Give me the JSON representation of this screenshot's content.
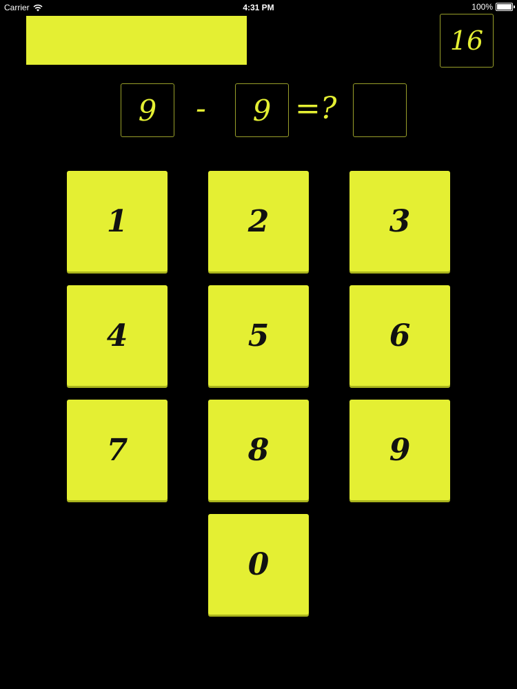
{
  "status_bar": {
    "carrier": "Carrier",
    "time": "4:31 PM",
    "battery": "100%",
    "wifi_icon": "wifi-icon",
    "battery_icon": "battery-icon"
  },
  "progress": {
    "fraction": 1.0,
    "color": "#e4ef33"
  },
  "score": "16",
  "equation": {
    "left_operand": "9",
    "operator": "-",
    "right_operand": "9",
    "equals": "=?",
    "answer": ""
  },
  "keypad": {
    "keys": [
      "1",
      "2",
      "3",
      "4",
      "5",
      "6",
      "7",
      "8",
      "9",
      "0"
    ]
  },
  "colors": {
    "background": "#000000",
    "accent": "#e4ef33",
    "box_border": "#9aa02a",
    "key_text": "#111111"
  }
}
